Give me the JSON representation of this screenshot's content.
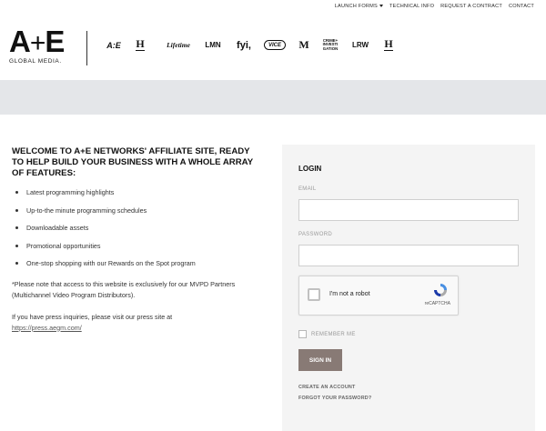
{
  "topnav": {
    "launch_forms": "LAUNCH FORMS",
    "technical_info": "TECHNICAL INFO",
    "request_contract": "REQUEST A CONTRACT",
    "contact": "CONTACT"
  },
  "logo": {
    "mark_a": "A",
    "mark_plus": "+",
    "mark_e": "E",
    "subtitle": "GLOBAL MEDIA."
  },
  "brands": [
    {
      "name": "ae-brand-logo",
      "text": "A:E"
    },
    {
      "name": "history-brand-logo",
      "text": "H"
    },
    {
      "name": "lifetime-brand-logo",
      "text": "Lifetime"
    },
    {
      "name": "lmn-brand-logo",
      "text": "LMN"
    },
    {
      "name": "fyi-brand-logo",
      "text": "fyi,"
    },
    {
      "name": "vice-brand-logo",
      "text": "VICE"
    },
    {
      "name": "military-history-brand-logo",
      "text": "M"
    },
    {
      "name": "crime-investigation-brand-logo",
      "text": "CRIME+ INVESTI GATION"
    },
    {
      "name": "lrw-brand-logo",
      "text": "LRW"
    },
    {
      "name": "history-vault-brand-logo",
      "text": "H"
    }
  ],
  "welcome": {
    "heading": "WELCOME TO A+E NETWORKS' AFFILIATE SITE, READY TO HELP BUILD YOUR BUSINESS WITH A WHOLE ARRAY OF FEATURES:",
    "features": [
      "Latest programming highlights",
      "Up-to-the minute programming schedules",
      "Downloadable assets",
      "Promotional opportunities",
      "One-stop shopping with our Rewards on the Spot program"
    ],
    "note": "*Please note that access to this website is exclusively for our MVPD Partners (Multichannel Video Program Distributors).",
    "press_text": "If you have press inquiries, please visit our press site at",
    "press_link": "https://press.aegm.com/"
  },
  "login": {
    "title": "LOGIN",
    "email_label": "EMAIL",
    "email_value": "",
    "password_label": "PASSWORD",
    "password_value": "",
    "recaptcha_label": "I'm not a robot",
    "recaptcha_brand": "reCAPTCHA",
    "remember_label": "REMEMBER ME",
    "signin_label": "SIGN IN",
    "create_account": "CREATE AN ACCOUNT",
    "forgot_password": "FORGOT YOUR PASSWORD?"
  },
  "colors": {
    "band": "#e4e6e9",
    "panel": "#f4f4f4",
    "signin_button": "#887a75"
  }
}
